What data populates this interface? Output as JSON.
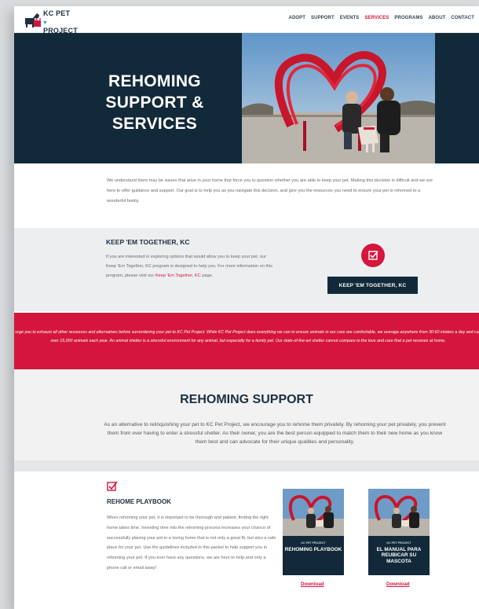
{
  "header": {
    "logo_line1": "KC PET",
    "logo_line2": "PROJECT",
    "nav": [
      "ADOPT",
      "SUPPORT",
      "EVENTS",
      "SERVICES",
      "PROGRAMS",
      "ABOUT",
      "CONTACT"
    ],
    "active_nav": "SERVICES"
  },
  "hero": {
    "title_line1": "REHOMING",
    "title_line2": "SUPPORT &",
    "title_line3": "SERVICES"
  },
  "intro": {
    "text": "We understand there may be issues that arise in your home that force you to question whether you are able to keep your pet. Making this decision is difficult and we are here to offer guidance and support. Our goal is to help you as you navigate this decision, and give you the resources you need to ensure your pet is rehomed to a wonderful family."
  },
  "keep_together": {
    "title": "KEEP 'EM TOGETHER, KC",
    "text_before": "If you are interested in exploring options that would allow you to keep your pet, our Keep 'Em Together, KC program is designed to help you. For more information on this program, please visit our ",
    "link_text": "Keep 'Em Together, KC",
    "text_after": " page.",
    "button_label": "KEEP 'EM TOGETHER, KC",
    "icon": "checkbox-icon"
  },
  "banner": {
    "text": "We urge you to exhaust all other resources and alternatives before surrendering your pet to KC Pet Project. While KC Pet Project does everything we can to ensure animals in our care are comfortable, we average anywhere from 30-60 intakes a day and care for over 15,000 animals each year. An animal shelter is a stressful environment for any animal, but especially for a family pet. Our state-of-the-art shelter cannot compare to the love and care that a pet receives at home."
  },
  "rehoming_support": {
    "title": "REHOMING SUPPORT",
    "text": "As an alternative to relinquishing your pet to KC Pet Project, we encourage you to rehome them privately. By rehoming your pet privately, you prevent them from ever having to enter a stressful shelter. As their owner, you are the best person equipped to match them to their new home as you know them best and can advocate for their unique qualities and personality."
  },
  "playbook": {
    "title": "REHOME PLAYBOOK",
    "icon": "checkbox-icon",
    "text": "When rehoming your pet, it is important to be thorough and patient, finding the right home takes time. Investing time into the rehoming process increases your chance of successfully placing your pet in a loving home that is not only a great fit, but also a safe place for your pet. Use the guidelines included in this packet to help support you in rehoming your pet. If you ever have any questions, we are here to help and only a phone call or email away!",
    "covers": [
      {
        "kicker": "KC PET PROJECT",
        "title": "REHOMING PLAYBOOK",
        "download": "Download"
      },
      {
        "kicker": "KC PET PROJECT",
        "title": "EL MANUAL PARA REUBICAR SU MASCOTA",
        "download": "Download"
      }
    ]
  },
  "colors": {
    "navy": "#12293a",
    "brand_red": "#d4163c",
    "light_gray": "#edeef0"
  }
}
